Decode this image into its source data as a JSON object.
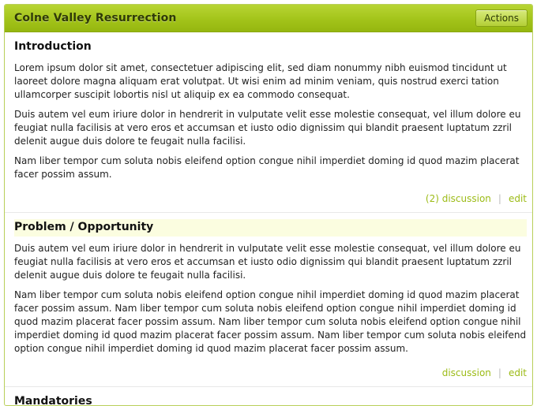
{
  "header": {
    "title": "Colne Valley Resurrection",
    "actions_label": "Actions"
  },
  "sections": [
    {
      "title": "Introduction",
      "paragraphs": [
        "Lorem ipsum dolor sit amet, consectetuer adipiscing elit, sed diam nonummy nibh euismod tincidunt ut laoreet dolore magna aliquam erat volutpat. Ut wisi enim ad minim veniam, quis nostrud exerci tation ullamcorper suscipit lobortis nisl ut aliquip ex ea commodo consequat.",
        "Duis autem vel eum iriure dolor in hendrerit in vulputate velit esse molestie consequat, vel illum dolore eu feugiat nulla facilisis at vero eros et accumsan et iusto odio dignissim qui blandit praesent luptatum zzril delenit augue duis dolore te feugait nulla facilisi.",
        "Nam liber tempor cum soluta nobis eleifend option congue nihil imperdiet doming id quod mazim placerat facer possim assum."
      ],
      "discussion_label": "(2) discussion",
      "separator": "|",
      "edit_label": "edit"
    },
    {
      "title": "Problem / Opportunity",
      "paragraphs": [
        "Duis autem vel eum iriure dolor in hendrerit in vulputate velit esse molestie consequat, vel illum dolore eu feugiat nulla facilisis at vero eros et accumsan et iusto odio dignissim qui blandit praesent luptatum zzril delenit augue duis dolore te feugait nulla facilisi.",
        "Nam liber tempor cum soluta nobis eleifend option congue nihil imperdiet doming id quod mazim placerat facer possim assum. Nam liber tempor cum soluta nobis eleifend option congue nihil imperdiet doming id quod mazim placerat facer possim assum. Nam liber tempor cum soluta nobis eleifend option congue nihil imperdiet doming id quod mazim placerat facer possim assum. Nam liber tempor cum soluta nobis eleifend option congue nihil imperdiet doming id quod mazim placerat facer possim assum."
      ],
      "discussion_label": "discussion",
      "separator": "|",
      "edit_label": "edit"
    },
    {
      "title": "Mandatories"
    }
  ]
}
